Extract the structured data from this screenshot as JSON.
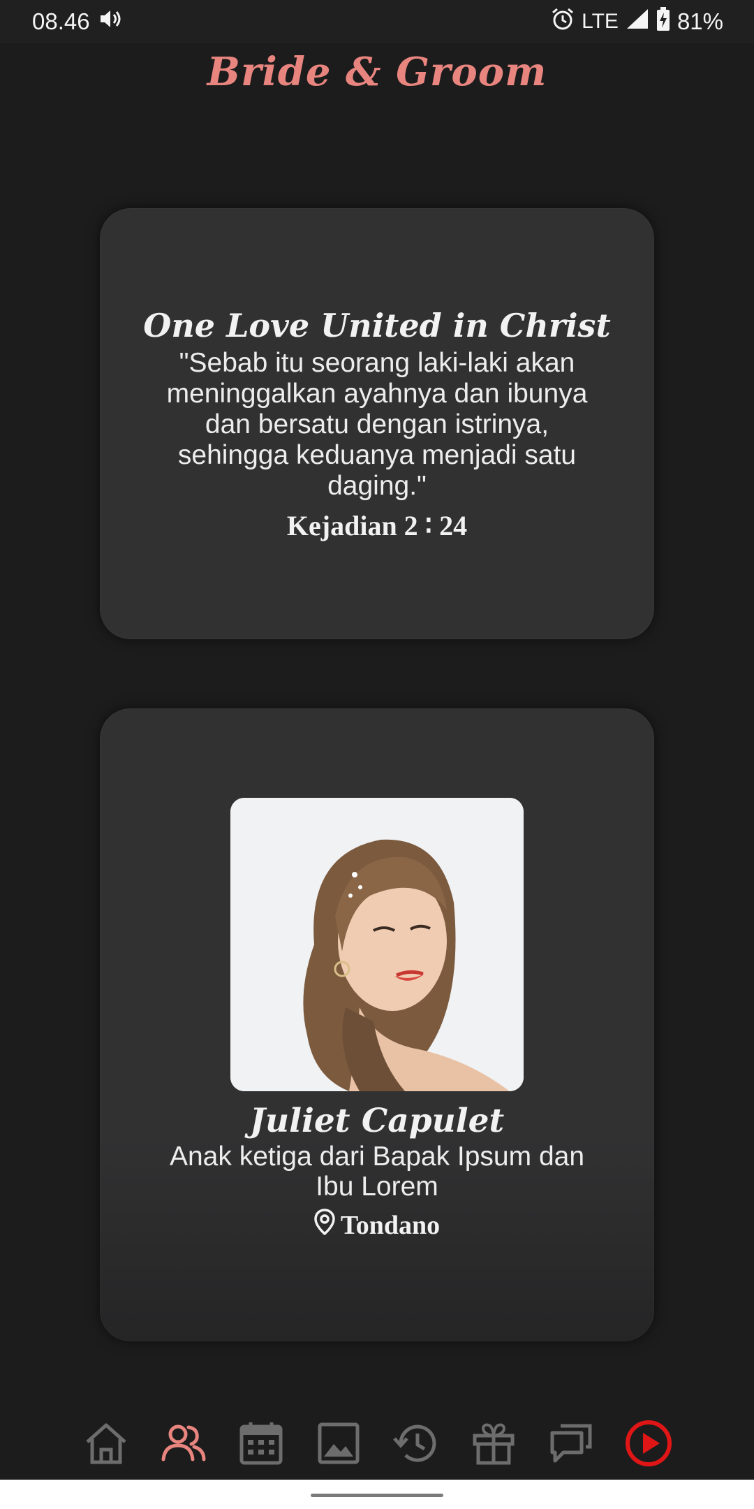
{
  "status_bar": {
    "time": "08.46",
    "network": "LTE",
    "battery": "81%",
    "icons": [
      "volume-icon",
      "alarm-icon",
      "signal-icon",
      "battery-charging-icon"
    ]
  },
  "header": {
    "title": "Bride & Groom"
  },
  "verse_card": {
    "title": "One Love United in Christ",
    "text": "\"Sebab itu seorang laki-laki akan meninggalkan ayahnya dan ibunya dan bersatu dengan istrinya, sehingga keduanya menjadi satu daging.\"",
    "reference": "Kejadian 2 ∶ 24"
  },
  "bride_card": {
    "name": "Juliet Capulet",
    "description": "Anak ketiga dari Bapak Ipsum dan Ibu Lorem",
    "location": "Tondano",
    "icons": [
      "location-pin-icon"
    ]
  },
  "bottom_nav": {
    "items": [
      {
        "icon": "home-icon",
        "active": false
      },
      {
        "icon": "couple-icon",
        "active": true
      },
      {
        "icon": "calendar-icon",
        "active": false
      },
      {
        "icon": "gallery-icon",
        "active": false
      },
      {
        "icon": "history-icon",
        "active": false
      },
      {
        "icon": "gift-icon",
        "active": false
      },
      {
        "icon": "chat-icon",
        "active": false
      },
      {
        "icon": "play-music-icon",
        "active": false
      }
    ]
  },
  "colors": {
    "accent": "#e9857f",
    "inactive_icon": "#6d6d6d",
    "play_button": "#e01616",
    "background": "#1c1c1d",
    "card": "#313132"
  }
}
